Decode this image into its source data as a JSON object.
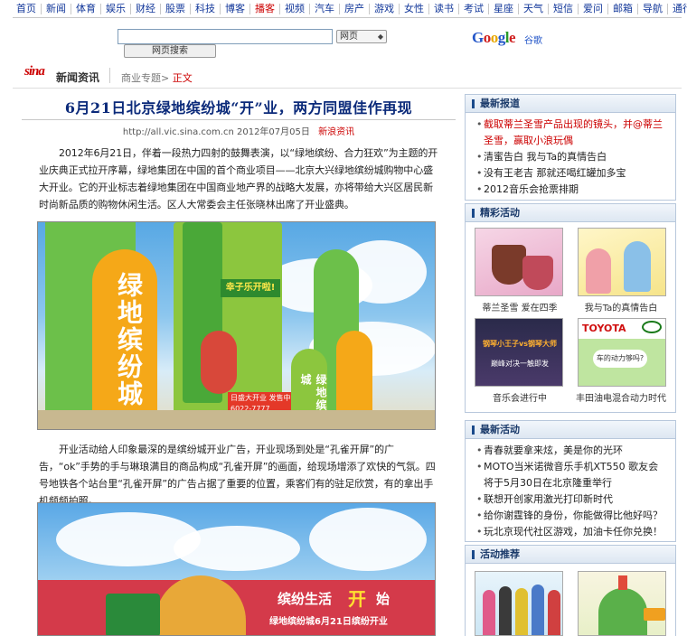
{
  "topnav": [
    "首页",
    "新闻",
    "体育",
    "娱乐",
    "财经",
    "股票",
    "科技",
    "博客",
    "播客",
    "视频",
    "汽车",
    "房产",
    "游戏",
    "女性",
    "读书",
    "考试",
    "星座",
    "天气",
    "短信",
    "爱问",
    "邮箱",
    "导航",
    "通行证"
  ],
  "topnav_active_index": 8,
  "search": {
    "button_label": "网页搜索",
    "select_value": "网页",
    "google_logo": "Google",
    "google_cn": "谷歌"
  },
  "brand": {
    "logo": "sina",
    "name": "新闻资讯",
    "crumb1": "商业专题>",
    "crumb2": "正文"
  },
  "article": {
    "title": "6月21日北京绿地缤纷城“开”业，两方同盟佳作再现",
    "meta_url": "http://all.vic.sina.com.cn",
    "meta_date": "2012年07月05日",
    "meta_source": "新浪资讯",
    "para1": "2012年6月21日，伴着一段热力四射的鼓舞表演，以“绿地缤纷、合力狂欢”为主题的开业庆典正式拉开序幕，绿地集团在中国的首个商业项目——北京大兴绿地缤纷城购物中心盛大开业。它的开业标志着绿地集团在中国商业地产界的战略大发展，亦将带给大兴区居民新时尚新品质的购物休闲生活。区人大常委会主任张晓林出席了开业盛典。",
    "para2": "开业活动给人印象最深的是缤纷城开业广告，开业现场到处是“孔雀开屏”的广告，“ok”手势的手与琳琅满目的商品构成“孔雀开屏”的画面，给现场增添了欢快的气氛。四号地铁各个站台里“孔雀开屏”的广告占据了重要的位置，乘客们有的驻足欣赏，有的拿出手机频频拍照。",
    "photo1_signs": {
      "tower": "绿地缤纷城",
      "banner": "幸子乐开啦!",
      "small": "绿地缤纷城",
      "phone": "日盛大开业 发售中 6022-7777"
    },
    "photo2_signs": {
      "banner1": "缤纷生活",
      "banner2": "开",
      "banner3": "始",
      "date": "绿地缤纷城6月21日缤纷开业"
    }
  },
  "sidebar": {
    "latest_reports": {
      "title": "最新报道",
      "items": [
        "截取蒂兰圣雪产品出现的镜头，并@蒂兰圣雪，赢取小浪玩偶",
        "清蜜告白 我与Ta的真情告白",
        "没有王老吉 那就还喝红罐加多宝",
        "2012音乐会抢票排期"
      ]
    },
    "featured": {
      "title": "精彩活动",
      "items": [
        {
          "caption": "蒂兰圣雪 爱在四季"
        },
        {
          "caption": "我与Ta的真情告白"
        },
        {
          "caption": "音乐会进行中",
          "overlay1": "钢琴小王子vs钢琴大师",
          "overlay2": "巅峰对决一触即发"
        },
        {
          "caption": "丰田油电混合动力时代",
          "brand": "TOYOTA",
          "bubble": "车的动力够吗?"
        }
      ]
    },
    "latest_activities": {
      "title": "最新活动",
      "items": [
        "青春就要拿来炫，美是你的光环",
        "MOTO当米诺微音乐手机XT550 歌友会将于5月30日在北京隆重举行",
        "联想开创家用激光打印新时代",
        "给你谢霆锋的身份，你能做得比他好吗？",
        "玩北京现代社区游戏，加油卡任你兑换！"
      ]
    },
    "recommend": {
      "title": "活动推荐"
    }
  },
  "colors": {
    "nav_blue": "#12379a",
    "title_blue": "#0b2a7a",
    "accent_red": "#cc0000",
    "sidebar_border": "#b8c8dc"
  }
}
